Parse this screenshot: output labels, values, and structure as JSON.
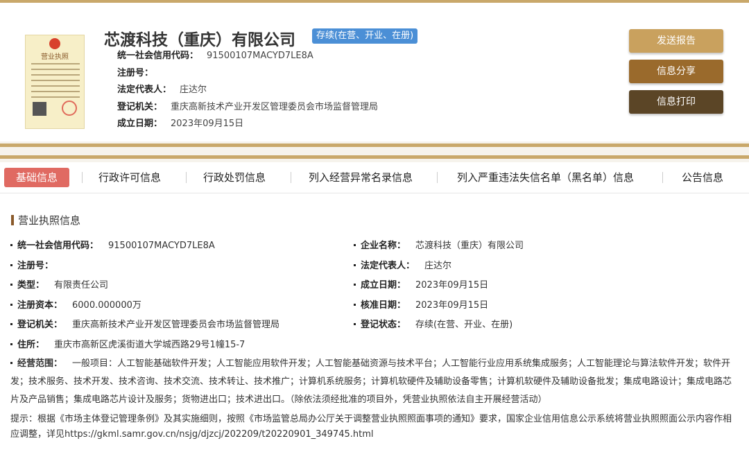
{
  "company": {
    "name": "芯渡科技（重庆）有限公司",
    "status": "存续(在营、开业、在册)"
  },
  "license_image": {
    "title": "营业执照"
  },
  "header_info": [
    {
      "label": "统一社会信用代码：",
      "value": "91500107MACYD7LE8A"
    },
    {
      "label": "注册号：",
      "value": ""
    },
    {
      "label": "法定代表人：",
      "value": "庄达尔"
    },
    {
      "label": "登记机关：",
      "value": "重庆高新技术产业开发区管理委员会市场监督管理局"
    },
    {
      "label": "成立日期：",
      "value": "2023年09月15日"
    }
  ],
  "buttons": {
    "send_report": "发送报告",
    "share": "信息分享",
    "print": "信息打印"
  },
  "tabs": [
    "基础信息",
    "行政许可信息",
    "行政处罚信息",
    "列入经营异常名录信息",
    "列入严重违法失信名单（黑名单）信息",
    "公告信息"
  ],
  "section": {
    "title": "营业执照信息"
  },
  "fields_left": [
    {
      "label": "统一社会信用代码：",
      "value": "91500107MACYD7LE8A"
    },
    {
      "label": "注册号：",
      "value": ""
    },
    {
      "label": "类型：",
      "value": "有限责任公司"
    },
    {
      "label": "注册资本：",
      "value": "6000.000000万"
    },
    {
      "label": "登记机关：",
      "value": "重庆高新技术产业开发区管理委员会市场监督管理局"
    },
    {
      "label": "住所：",
      "value": "重庆市高新区虎溪街道大学城西路29号1幢15-7"
    }
  ],
  "fields_right": [
    {
      "label": "企业名称：",
      "value": "芯渡科技（重庆）有限公司"
    },
    {
      "label": "法定代表人：",
      "value": "庄达尔"
    },
    {
      "label": "成立日期：",
      "value": "2023年09月15日"
    },
    {
      "label": "核准日期：",
      "value": "2023年09月15日"
    },
    {
      "label": "登记状态：",
      "value": "存续(在营、开业、在册)"
    }
  ],
  "business_scope": {
    "label": "经营范围：",
    "value": "一般项目：人工智能基础软件开发；人工智能应用软件开发；人工智能基础资源与技术平台；人工智能行业应用系统集成服务；人工智能理论与算法软件开发；软件开发；技术服务、技术开发、技术咨询、技术交流、技术转让、技术推广；计算机系统服务；计算机软硬件及辅助设备零售；计算机软硬件及辅助设备批发；集成电路设计；集成电路芯片及产品销售；集成电路芯片设计及服务；货物进出口；技术进出口。（除依法须经批准的项目外，凭营业执照依法自主开展经营活动）"
  },
  "notice": "提示：根据《市场主体登记管理条例》及其实施细则，按照《市场监管总局办公厅关于调整营业执照照面事项的通知》要求，国家企业信用信息公示系统将营业执照照面公示内容作相应调整，详见https://gkml.samr.gov.cn/nsjg/djzcj/202209/t20220901_349745.html",
  "colors": {
    "gold": "#c9a86a",
    "active_tab": "#e06a62",
    "status_tag": "#4b8fd6",
    "btn1": "#c9a15e",
    "btn2": "#9a6a2c",
    "btn3": "#5b4526"
  }
}
